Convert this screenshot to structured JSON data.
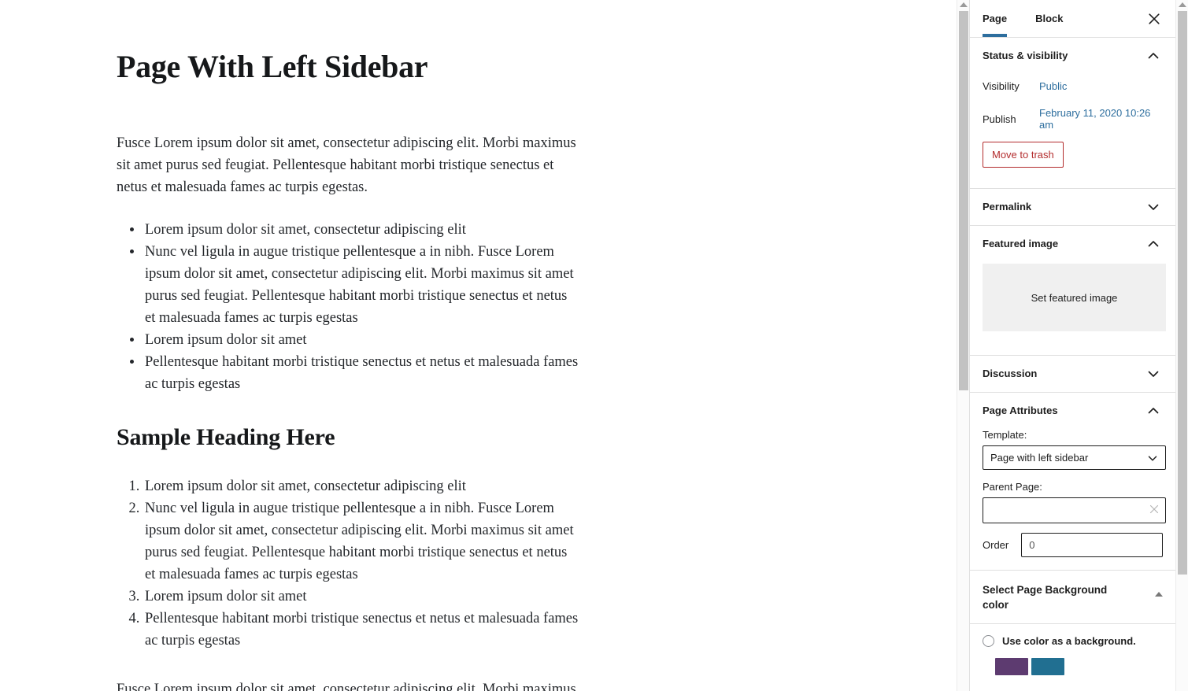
{
  "editor": {
    "post_title": "Page With Left Sidebar",
    "intro_paragraph": "Fusce Lorem ipsum dolor sit amet, consectetur adipiscing elit. Morbi maximus sit amet purus sed feugiat. Pellentesque habitant morbi tristique senectus et netus et malesuada fames ac turpis egestas.",
    "bullet_list": [
      "Lorem ipsum dolor sit amet, consectetur adipiscing elit",
      "Nunc vel ligula in augue tristique pellentesque a in nibh. Fusce Lorem ipsum dolor sit amet, consectetur adipiscing elit. Morbi maximus sit amet purus sed feugiat. Pellentesque habitant morbi tristique senectus et netus et malesuada fames ac turpis egestas",
      "Lorem ipsum dolor sit amet",
      "Pellentesque habitant morbi tristique senectus et netus et malesuada fames ac turpis egestas"
    ],
    "heading_2": "Sample Heading Here",
    "numbered_list": [
      "Lorem ipsum dolor sit amet, consectetur adipiscing elit",
      "Nunc vel ligula in augue tristique pellentesque a in nibh. Fusce Lorem ipsum dolor sit amet, consectetur adipiscing elit. Morbi maximus sit amet purus sed feugiat. Pellentesque habitant morbi tristique senectus et netus et malesuada fames ac turpis egestas",
      "Lorem ipsum dolor sit amet",
      "Pellentesque habitant morbi tristique senectus et netus et malesuada fames ac turpis egestas"
    ],
    "partial_next_line": "Fusce Lorem ipsum dolor sit amet, consectetur adipiscing elit. Morbi maximus sit"
  },
  "sidebar": {
    "tabs": [
      {
        "label": "Page",
        "active": true
      },
      {
        "label": "Block",
        "active": false
      }
    ],
    "close_label": "Close settings",
    "status_visibility": {
      "title": "Status & visibility",
      "expanded": true,
      "visibility_label": "Visibility",
      "visibility_value": "Public",
      "publish_label": "Publish",
      "publish_value": "February 11, 2020 10:26 am",
      "trash_label": "Move to trash"
    },
    "permalink": {
      "title": "Permalink",
      "expanded": false
    },
    "featured_image": {
      "title": "Featured image",
      "expanded": true,
      "placeholder": "Set featured image"
    },
    "discussion": {
      "title": "Discussion",
      "expanded": false
    },
    "page_attributes": {
      "title": "Page Attributes",
      "expanded": true,
      "template_label": "Template:",
      "template_value": "Page with left sidebar",
      "parent_label": "Parent Page:",
      "parent_value": "",
      "parent_placeholder": "",
      "order_label": "Order",
      "order_value": "0"
    },
    "background_color": {
      "title": "Select Page Background color",
      "expanded": true,
      "radio_label": "Use color as a background.",
      "radio_checked": false,
      "swatches": [
        "#5d3b70",
        "#216f91"
      ]
    }
  },
  "colors": {
    "accent_blue": "#2d6e9e",
    "link_blue": "#2d6e9e",
    "danger_red": "#b32d2e",
    "panel_border": "#e0e0e0",
    "placeholder_gray": "#f0f0f0",
    "scrollbar_thumb": "#c2c2c2"
  }
}
